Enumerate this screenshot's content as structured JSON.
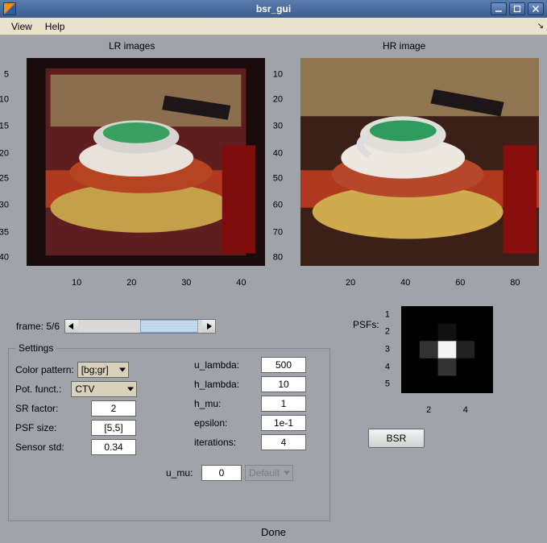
{
  "window": {
    "title": "bsr_gui"
  },
  "menus": {
    "view": "View",
    "help": "Help"
  },
  "plots": {
    "lr_title": "LR images",
    "hr_title": "HR image",
    "lr_yticks": [
      "5",
      "10",
      "15",
      "20",
      "25",
      "30",
      "35",
      "40"
    ],
    "lr_xticks": [
      "10",
      "20",
      "30",
      "40"
    ],
    "hr_yticks": [
      "10",
      "20",
      "30",
      "40",
      "50",
      "60",
      "70",
      "80"
    ],
    "hr_xticks": [
      "20",
      "40",
      "60",
      "80"
    ]
  },
  "frame": {
    "label": "frame: 5/6"
  },
  "settings": {
    "legend": "Settings",
    "color_pattern_label": "Color pattern:",
    "color_pattern_value": "[bg;gr]",
    "pot_funct_label": "Pot. funct.:",
    "pot_funct_value": "CTV",
    "sr_factor_label": "SR factor:",
    "sr_factor_value": "2",
    "psf_size_label": "PSF size:",
    "psf_size_value": "[5,5]",
    "sensor_std_label": "Sensor std:",
    "sensor_std_value": "0.34",
    "u_lambda_label": "u_lambda:",
    "u_lambda_value": "500",
    "h_lambda_label": "h_lambda:",
    "h_lambda_value": "10",
    "h_mu_label": "h_mu:",
    "h_mu_value": "1",
    "epsilon_label": "epsilon:",
    "epsilon_value": "1e-1",
    "iterations_label": "iterations:",
    "iterations_value": "4",
    "u_mu_label": "u_mu:",
    "u_mu_value": "0",
    "u_mu_mode": "Default"
  },
  "psfs": {
    "label": "PSFs:",
    "yticks": [
      "1",
      "2",
      "3",
      "4",
      "5"
    ],
    "xticks": [
      "2",
      "4"
    ]
  },
  "bsr_button": "BSR",
  "status": "Done"
}
